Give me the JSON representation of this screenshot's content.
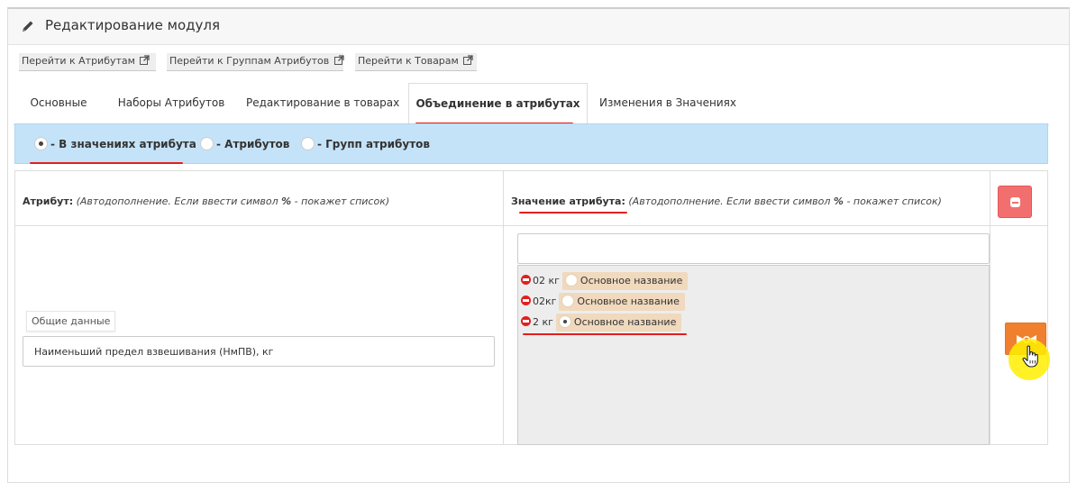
{
  "panel": {
    "title": "Редактирование модуля",
    "icon": "pencil-icon"
  },
  "quick_links": [
    {
      "label": "Перейти к Атрибутам",
      "icon": "external-link-icon"
    },
    {
      "label": "Перейти к Группам Атрибутов",
      "icon": "external-link-icon"
    },
    {
      "label": "Перейти к Товарам",
      "icon": "external-link-icon"
    }
  ],
  "tabs": [
    {
      "label": "Основные",
      "active": false
    },
    {
      "label": "Наборы Атрибутов",
      "active": false
    },
    {
      "label": "Редактирование в товарах",
      "active": false
    },
    {
      "label": "Объединение в атрибутах",
      "active": true
    },
    {
      "label": "Изменения в Значениях",
      "active": false
    }
  ],
  "mode_options": [
    {
      "label": "- В значениях атрибута",
      "selected": true
    },
    {
      "label": "- Атрибутов",
      "selected": false
    },
    {
      "label": "- Групп атрибутов",
      "selected": false
    }
  ],
  "table": {
    "attr_header": {
      "label": "Атрибут:",
      "hint_prefix": "(Автодополнение. Если ввести символ ",
      "hint_symbol": "%",
      "hint_suffix": " - покажет список)"
    },
    "value_header": {
      "label": "Значение атрибута:",
      "hint_prefix": "(Автодополнение. Если ввести символ ",
      "hint_symbol": "%",
      "hint_suffix": " - покажет список)"
    },
    "group_badge": "Общие данные",
    "attribute_input_value": "Наименьший предел взвешивания (НмПВ), кг",
    "value_input_value": "",
    "values": [
      {
        "value": "02 кг",
        "chip_label": "Основное название",
        "selected": false
      },
      {
        "value": "02кг",
        "chip_label": "Основное название",
        "selected": false
      },
      {
        "value": "2 кг",
        "chip_label": "Основное название",
        "selected": true
      }
    ]
  },
  "colors": {
    "mode_bar_bg": "#c5e3f8",
    "delete_button": "#f26f6f",
    "merge_button": "#f0802e",
    "chip_bg": "#f0d9bd",
    "annotation_red": "#e31e1e",
    "cursor_highlight": "#ffee00"
  }
}
